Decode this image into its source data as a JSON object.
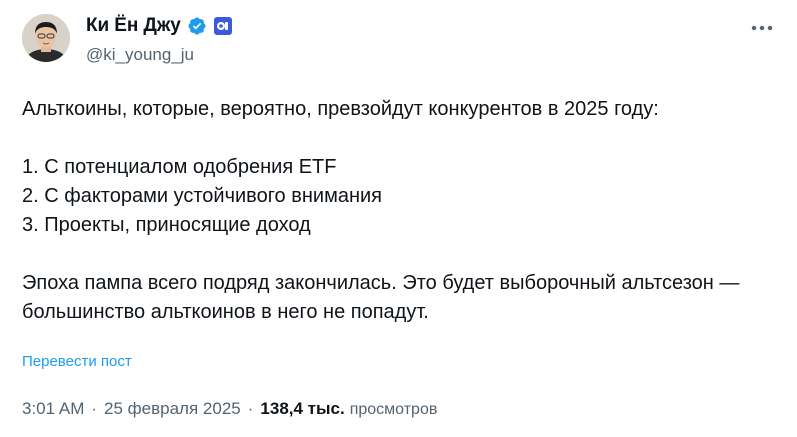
{
  "author": {
    "display_name": "Ки Ён Джу",
    "handle": "@ki_young_ju",
    "verified_color": "#1d9bf0",
    "affiliation_badge_color": "#3b5bdb"
  },
  "tweet": {
    "paragraphs": [
      "Альткоины, которые, вероятно, превзойдут конкурентов в 2025 году:",
      "1. С потенциалом одобрения ETF",
      "2. С факторами устойчивого внимания",
      "3. Проекты, приносящие доход",
      "Эпоха пампа всего подряд закончилась. Это будет выборочный альтсезон — большинство альткоинов в него не попадут."
    ],
    "translate_label": "Перевести пост"
  },
  "meta": {
    "time": "3:01 AM",
    "date": "25 февраля 2025",
    "separator": "·",
    "views_count": "138,4 тыс.",
    "views_label": "просмотров"
  },
  "icons": {
    "verified": "verified-badge-icon",
    "affiliation": "affiliation-badge-icon",
    "more": "more-options-icon"
  }
}
